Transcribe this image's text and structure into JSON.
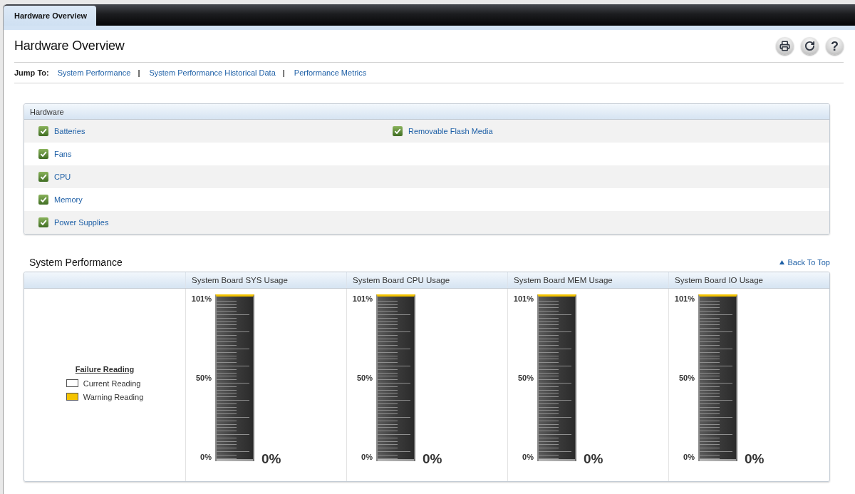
{
  "tabs": [
    {
      "label": "Hardware Overview",
      "selected": true
    }
  ],
  "header": {
    "title": "Hardware Overview",
    "actions": [
      {
        "kind": "print"
      },
      {
        "kind": "refresh"
      },
      {
        "kind": "help",
        "label": "?"
      }
    ]
  },
  "jump_to": {
    "label": "Jump To:",
    "items": [
      {
        "kind": "link",
        "text": "System Performance"
      },
      {
        "kind": "separator",
        "text": "|"
      },
      {
        "kind": "link",
        "text": "System Performance Historical Data"
      },
      {
        "kind": "separator",
        "text": "|"
      },
      {
        "kind": "link",
        "text": "Performance Metrics"
      }
    ]
  },
  "hardware": {
    "title": "Hardware",
    "columns": [
      {
        "items": [
          {
            "name": "Batteries",
            "ok": true
          },
          {
            "name": "Fans",
            "ok": true
          },
          {
            "name": "CPU",
            "ok": true
          },
          {
            "name": "Memory",
            "ok": true
          },
          {
            "name": "Power Supplies",
            "ok": true
          }
        ]
      },
      {
        "items": [
          {
            "name": "Removable Flash Media",
            "ok": true
          }
        ]
      }
    ]
  },
  "system_performance": {
    "title": "System Performance",
    "back_to_top": "Back To Top",
    "legend": {
      "title": "Failure Reading",
      "items": [
        {
          "label": "Current Reading",
          "color": "#ffffff"
        },
        {
          "label": "Warning Reading",
          "color": "#f5c400"
        }
      ]
    },
    "gauges": [
      {
        "title": "System Board SYS Usage",
        "scale": [
          "101%",
          "50%",
          "0%"
        ],
        "level": 0,
        "reading": "0%"
      },
      {
        "title": "System Board CPU Usage",
        "scale": [
          "101%",
          "50%",
          "0%"
        ],
        "level": 0,
        "reading": "0%"
      },
      {
        "title": "System Board MEM Usage",
        "scale": [
          "101%",
          "50%",
          "0%"
        ],
        "level": 0,
        "reading": "0%"
      },
      {
        "title": "System Board IO Usage",
        "scale": [
          "101%",
          "50%",
          "0%"
        ],
        "level": 0,
        "reading": "0%"
      }
    ]
  }
}
